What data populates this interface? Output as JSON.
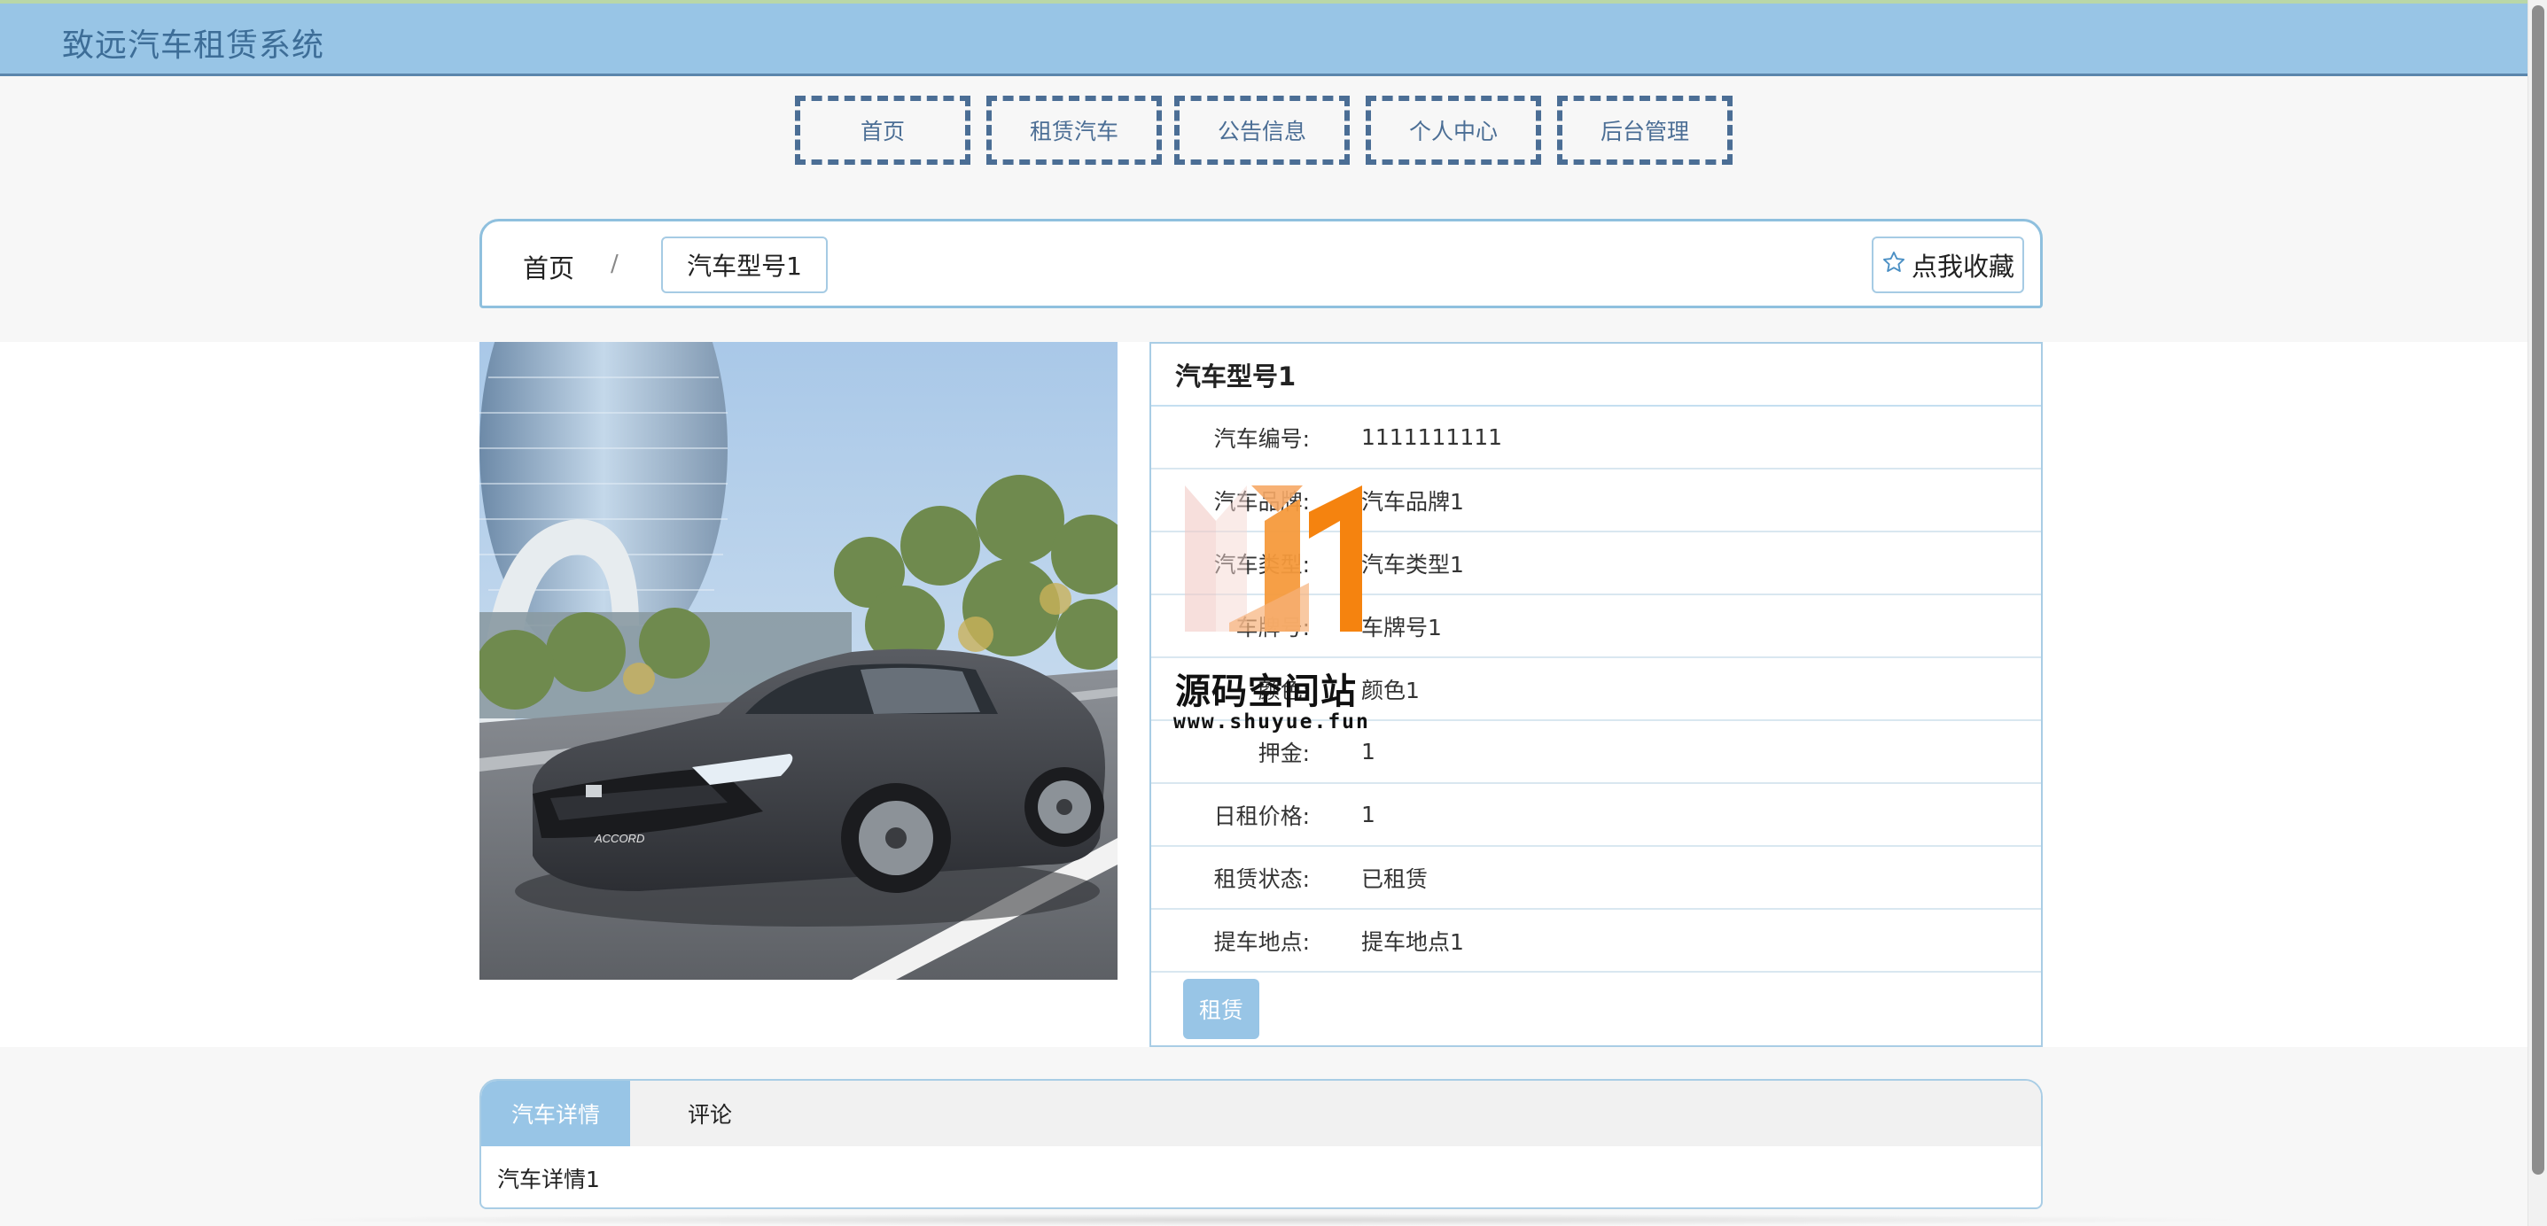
{
  "header": {
    "title": "致远汽车租赁系统"
  },
  "nav": {
    "items": [
      {
        "label": "首页"
      },
      {
        "label": "租赁汽车"
      },
      {
        "label": "公告信息"
      },
      {
        "label": "个人中心"
      },
      {
        "label": "后台管理"
      }
    ]
  },
  "breadcrumb": {
    "home": "首页",
    "separator": "/",
    "current": "汽车型号1"
  },
  "favorite": {
    "label": "点我收藏",
    "icon": "star-outline-icon"
  },
  "detail": {
    "title": "汽车型号1",
    "rows": [
      {
        "label": "汽车编号:",
        "value": "1111111111"
      },
      {
        "label": "汽车品牌:",
        "value": "汽车品牌1"
      },
      {
        "label": "汽车类型:",
        "value": "汽车类型1"
      },
      {
        "label": "车牌号:",
        "value": "车牌号1"
      },
      {
        "label": "颜色:",
        "value": "颜色1"
      },
      {
        "label": "押金:",
        "value": "1"
      },
      {
        "label": "日租价格:",
        "value": "1"
      },
      {
        "label": "租赁状态:",
        "value": "已租赁"
      },
      {
        "label": "提车地点:",
        "value": "提车地点1"
      }
    ],
    "rent_button": "租赁"
  },
  "tabs": {
    "items": [
      {
        "label": "汽车详情"
      },
      {
        "label": "评论"
      }
    ],
    "content": "汽车详情1"
  },
  "watermark": {
    "title": "源码空间站",
    "url": "www.shuyue.fun"
  },
  "colors": {
    "accent": "#98c5e6",
    "nav_border": "#4b6e95",
    "header_text": "#3d6d97"
  }
}
